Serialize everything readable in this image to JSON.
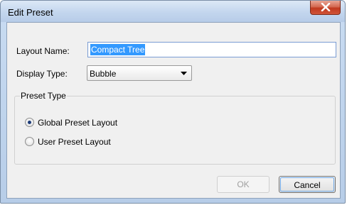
{
  "window": {
    "title": "Edit Preset"
  },
  "form": {
    "layout_name_label": "Layout Name:",
    "layout_name_value": "Compact Tree",
    "display_type_label": "Display Type:",
    "display_type_value": "Bubble"
  },
  "preset_type": {
    "legend": "Preset Type",
    "options": [
      {
        "label": "Global Preset Layout",
        "selected": true
      },
      {
        "label": "User Preset Layout",
        "selected": false
      }
    ]
  },
  "buttons": {
    "ok_label": "OK",
    "ok_enabled": false,
    "cancel_label": "Cancel"
  },
  "colors": {
    "selection": "#3399ff",
    "close_button": "#c7422a"
  },
  "icons": {
    "close": "close-icon",
    "dropdown": "chevron-down-icon"
  }
}
